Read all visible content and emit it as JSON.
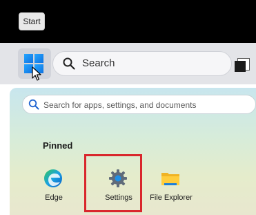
{
  "tooltip": {
    "text": "Start"
  },
  "taskbar": {
    "start_button": {
      "icon": "windows-logo-icon"
    },
    "search": {
      "label": "Search",
      "icon": "search-icon"
    },
    "taskview": {
      "icon": "task-view-icon"
    }
  },
  "start_menu": {
    "search": {
      "placeholder": "Search for apps, settings, and documents",
      "icon": "search-icon"
    },
    "pinned_label": "Pinned",
    "pinned_apps": [
      {
        "label": "Edge",
        "icon": "edge-icon"
      },
      {
        "label": "Settings",
        "icon": "gear-icon",
        "highlighted": true
      },
      {
        "label": "File Explorer",
        "icon": "folder-icon"
      }
    ]
  },
  "colors": {
    "highlight": "#d9262c",
    "accent": "#1172e0"
  }
}
